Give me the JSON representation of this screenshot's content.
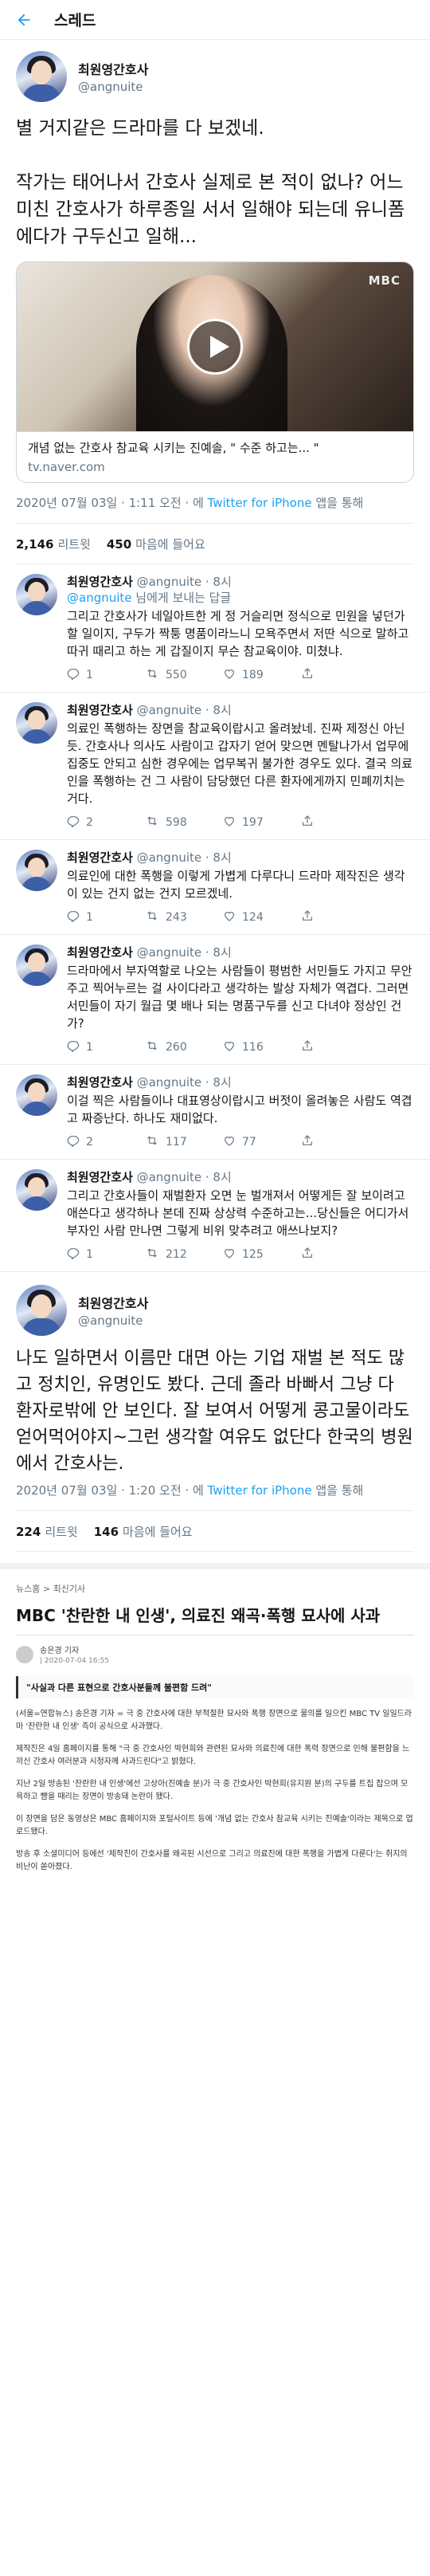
{
  "header": {
    "title": "스레드"
  },
  "tweet": {
    "display_name": "최원영간호사",
    "handle": "@angnuite",
    "text": "별 거지같은 드라마를 다 보겠네.\n\n작가는 태어나서 간호사 실제로 본 적이 없나? 어느 미친 간호사가 하루종일 서서 일해야 되는데 유니폼에다가 구두신고 일해...",
    "card": {
      "badge": "MBC",
      "title": "개념 없는 간호사 참교육 시키는 진예솔, \" 수준 하고는... \"",
      "site": "tv.naver.com"
    },
    "meta_time": "2020년 07월 03일 · 1:11 오전 · 에 ",
    "meta_source": "Twitter for iPhone",
    "meta_tail": " 앱을 통해",
    "retweets": "2,146",
    "retweets_label": "리트윗",
    "likes": "450",
    "likes_label": "마음에 들어요"
  },
  "replies": [
    {
      "name": "최원영간호사",
      "handle": "@angnuite",
      "time": "· 8시",
      "to_prefix": "",
      "to_user": "@angnuite",
      "to_suffix": " 님에게 보내는 답글",
      "text": "그리고 간호사가 네일아트한 게 정 거슬리면 정식으로 민원을 넣던가 할 일이지, 구두가 짝퉁 명품이라느니 모욕주면서 저딴 식으로 말하고 따귀 때리고 하는 게 갑질이지 무슨 참교육이야. 미쳤냐.",
      "reply": "1",
      "retweet": "550",
      "like": "189"
    },
    {
      "name": "최원영간호사",
      "handle": "@angnuite",
      "time": "· 8시",
      "to_prefix": "",
      "to_user": "",
      "to_suffix": "",
      "text": "의료인 폭행하는 장면을 참교육이랍시고 올려놨네. 진짜 제정신 아닌 듯. 간호사나 의사도 사람이고 갑자기 얻어 맞으면 멘탈나가서 업무에 집중도 안되고 심한 경우에는 업무복귀 불가한 경우도 있다. 결국 의료인을 폭행하는 건 그 사람이 담당했던 다른 환자에게까지 민폐끼치는 거다.",
      "reply": "2",
      "retweet": "598",
      "like": "197"
    },
    {
      "name": "최원영간호사",
      "handle": "@angnuite",
      "time": "· 8시",
      "to_prefix": "",
      "to_user": "",
      "to_suffix": "",
      "text": "의료인에 대한 폭행을 이렇게 가볍게 다루다니 드라마 제작진은 생각이 있는 건지 없는 건지 모르겠네.",
      "reply": "1",
      "retweet": "243",
      "like": "124"
    },
    {
      "name": "최원영간호사",
      "handle": "@angnuite",
      "time": "· 8시",
      "to_prefix": "",
      "to_user": "",
      "to_suffix": "",
      "text": "드라마에서 부자역할로 나오는 사람들이 평범한 서민들도 가지고 무안주고 찍어누르는 걸 사이다라고 생각하는 발상 자체가 역겹다. 그러면 서민들이 자기 월급 몇 배나 되는 명품구두를 신고 다녀야 정상인 건가?",
      "reply": "1",
      "retweet": "260",
      "like": "116"
    },
    {
      "name": "최원영간호사",
      "handle": "@angnuite",
      "time": "· 8시",
      "to_prefix": "",
      "to_user": "",
      "to_suffix": "",
      "text": "이걸 찍은 사람들이나 대표영상이랍시고 버젓이 올려놓은 사람도 역겹고 짜증난다. 하나도 재미없다.",
      "reply": "2",
      "retweet": "117",
      "like": "77"
    },
    {
      "name": "최원영간호사",
      "handle": "@angnuite",
      "time": "· 8시",
      "to_prefix": "",
      "to_user": "",
      "to_suffix": "",
      "text": "그리고 간호사들이 재벌환자 오면 눈 벌개져서 어떻게든 잘 보이려고 애쓴다고 생각하나 본데 진짜 상상력 수준하고는...당신들은 어디가서 부자인 사람 만나면 그렇게 비위 맞추려고 애쓰나보지?",
      "reply": "1",
      "retweet": "212",
      "like": "125"
    }
  ],
  "quote": {
    "display_name": "최원영간호사",
    "handle": "@angnuite",
    "text": "나도 일하면서 이름만 대면 아는 기업 재벌 본 적도 많고 정치인, 유명인도 봤다. 근데 졸라 바빠서 그냥 다 환자로밖에 안 보인다. 잘 보여서 어떻게 콩고물이라도 얻어먹어야지~그런 생각할 여유도 없단다 한국의 병원에서 간호사는.",
    "meta_time": "2020년 07월 03일 · 1:20 오전 · 에 ",
    "meta_source": "Twitter for iPhone",
    "meta_tail": " 앱을 통해",
    "retweets": "224",
    "retweets_label": "리트윗",
    "likes": "146",
    "likes_label": "마음에 들어요"
  },
  "news": {
    "breadcrumb_home": "뉴스홈",
    "breadcrumb_cat": "최신기사",
    "title": "MBC '찬란한 내 인생', 의료진 왜곡·폭행 묘사에 사과",
    "reporter": "송은경 기자",
    "date": "| 2020-07-04 16:55",
    "subhead": "\"사실과 다른 표현으로 간호사분들께 불편함 드려\"",
    "paragraphs": [
      "(서울=연합뉴스) 송은경 기자 = 극 중 간호사에 대한 부적절한 묘사와 폭행 장면으로 물의를 일으킨 MBC TV 일일드라마 '찬란한 내 인생' 측이 공식으로 사과했다.",
      "제작진은 4일 홈페이지를 통해 \"극 중 간호사인 박현희와 관련된 묘사와 의료진에 대한 폭력 장면으로 인해 불편함을 느끼신 간호사 여러분과 시청자께 사과드린다\"고 밝혔다.",
      "지난 2일 방송된 '찬란한 내 인생'에선 고상아(진예솔 분)가 극 중 간호사인 박현희(유지원 분)의 구두를 트집 잡으며 모욕하고 뺨을 때리는 장면이 방송돼 논란이 됐다.",
      "이 장면을 담은 동영상은 MBC 홈페이지와 포털사이트 등에 '개념 없는 간호사 참교육 시키는 진예솔'이라는 제목으로 업로드됐다.",
      "방송 후 소셜미디어 등에선 '제작진이 간호사를 왜곡된 시선으로 그리고 의료진에 대한 폭행을 가볍게 다룬다'는 취지의 비난이 쏟아졌다."
    ]
  }
}
